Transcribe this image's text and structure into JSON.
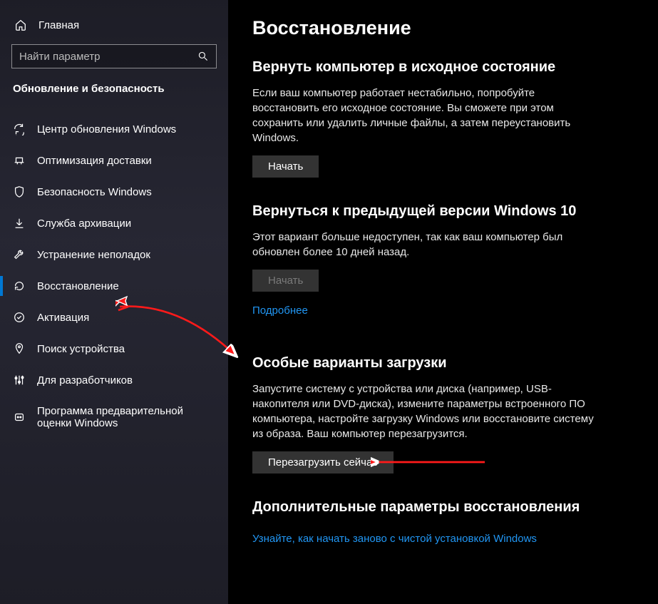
{
  "sidebar": {
    "home": "Главная",
    "search_placeholder": "Найти параметр",
    "header": "Обновление и безопасность",
    "items": [
      {
        "label": "Центр обновления Windows"
      },
      {
        "label": "Оптимизация доставки"
      },
      {
        "label": "Безопасность Windows"
      },
      {
        "label": "Служба архивации"
      },
      {
        "label": "Устранение неполадок"
      },
      {
        "label": "Восстановление"
      },
      {
        "label": "Активация"
      },
      {
        "label": "Поиск устройства"
      },
      {
        "label": "Для разработчиков"
      },
      {
        "label": "Программа предварительной оценки Windows"
      }
    ]
  },
  "main": {
    "title": "Восстановление",
    "reset": {
      "heading": "Вернуть компьютер в исходное состояние",
      "body": "Если ваш компьютер работает нестабильно, попробуйте восстановить его исходное состояние. Вы сможете при этом сохранить или удалить личные файлы, а затем переустановить Windows.",
      "button": "Начать"
    },
    "goback": {
      "heading": "Вернуться к предыдущей версии Windows 10",
      "body": "Этот вариант больше недоступен, так как ваш компьютер был обновлен более 10 дней назад.",
      "button": "Начать",
      "link": "Подробнее"
    },
    "advanced": {
      "heading": "Особые варианты загрузки",
      "body": "Запустите систему с устройства или диска (например, USB-накопителя или DVD-диска), измените параметры встроенного ПО компьютера, настройте загрузку Windows или восстановите систему из образа. Ваш компьютер перезагрузится.",
      "button": "Перезагрузить сейчас"
    },
    "more": {
      "heading": "Дополнительные параметры восстановления",
      "link": "Узнайте, как начать заново с чистой установкой Windows"
    }
  }
}
